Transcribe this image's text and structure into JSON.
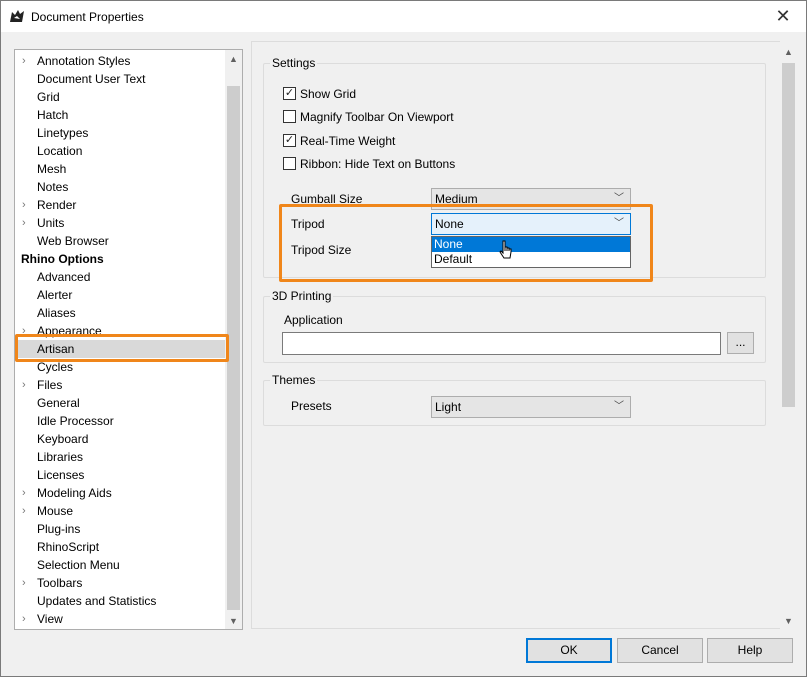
{
  "window": {
    "title": "Document Properties",
    "close_glyph": "✕"
  },
  "tree": {
    "items": [
      {
        "label": "Annotation Styles",
        "expand": true
      },
      {
        "label": "Document User Text",
        "expand": false
      },
      {
        "label": "Grid",
        "expand": false
      },
      {
        "label": "Hatch",
        "expand": false
      },
      {
        "label": "Linetypes",
        "expand": false
      },
      {
        "label": "Location",
        "expand": false
      },
      {
        "label": "Mesh",
        "expand": false
      },
      {
        "label": "Notes",
        "expand": false
      },
      {
        "label": "Render",
        "expand": true
      },
      {
        "label": "Units",
        "expand": true
      },
      {
        "label": "Web Browser",
        "expand": false
      },
      {
        "label": "Rhino Options",
        "header": true
      },
      {
        "label": "Advanced",
        "expand": false
      },
      {
        "label": "Alerter",
        "expand": false
      },
      {
        "label": "Aliases",
        "expand": false
      },
      {
        "label": "Appearance",
        "expand": true
      },
      {
        "label": "Artisan",
        "expand": false,
        "selected": true
      },
      {
        "label": "Cycles",
        "expand": false
      },
      {
        "label": "Files",
        "expand": true
      },
      {
        "label": "General",
        "expand": false
      },
      {
        "label": "Idle Processor",
        "expand": false
      },
      {
        "label": "Keyboard",
        "expand": false
      },
      {
        "label": "Libraries",
        "expand": false
      },
      {
        "label": "Licenses",
        "expand": false
      },
      {
        "label": "Modeling Aids",
        "expand": true
      },
      {
        "label": "Mouse",
        "expand": true
      },
      {
        "label": "Plug-ins",
        "expand": false
      },
      {
        "label": "RhinoScript",
        "expand": false
      },
      {
        "label": "Selection Menu",
        "expand": false
      },
      {
        "label": "Toolbars",
        "expand": true
      },
      {
        "label": "Updates and Statistics",
        "expand": false
      },
      {
        "label": "View",
        "expand": true
      }
    ]
  },
  "settings": {
    "group_title": "Settings",
    "show_grid": {
      "label": "Show Grid",
      "checked": true
    },
    "magnify_toolbar": {
      "label": "Magnify Toolbar On Viewport",
      "checked": false
    },
    "realtime_weight": {
      "label": "Real-Time Weight",
      "checked": true
    },
    "ribbon_hide_text": {
      "label": "Ribbon: Hide Text on Buttons",
      "checked": false
    },
    "gumball_size_label": "Gumball Size",
    "gumball_size_value": "Medium",
    "tripod_label": "Tripod",
    "tripod_value": "None",
    "tripod_size_label": "Tripod Size",
    "tripod_options": [
      "None",
      "Default"
    ]
  },
  "printing": {
    "group_title": "3D Printing",
    "application_label": "Application",
    "application_value": "",
    "browse_label": "..."
  },
  "themes": {
    "group_title": "Themes",
    "presets_label": "Presets",
    "presets_value": "Light"
  },
  "buttons": {
    "ok": "OK",
    "cancel": "Cancel",
    "help": "Help"
  },
  "colors": {
    "highlight": "#f0861a",
    "accent": "#0078d7"
  }
}
